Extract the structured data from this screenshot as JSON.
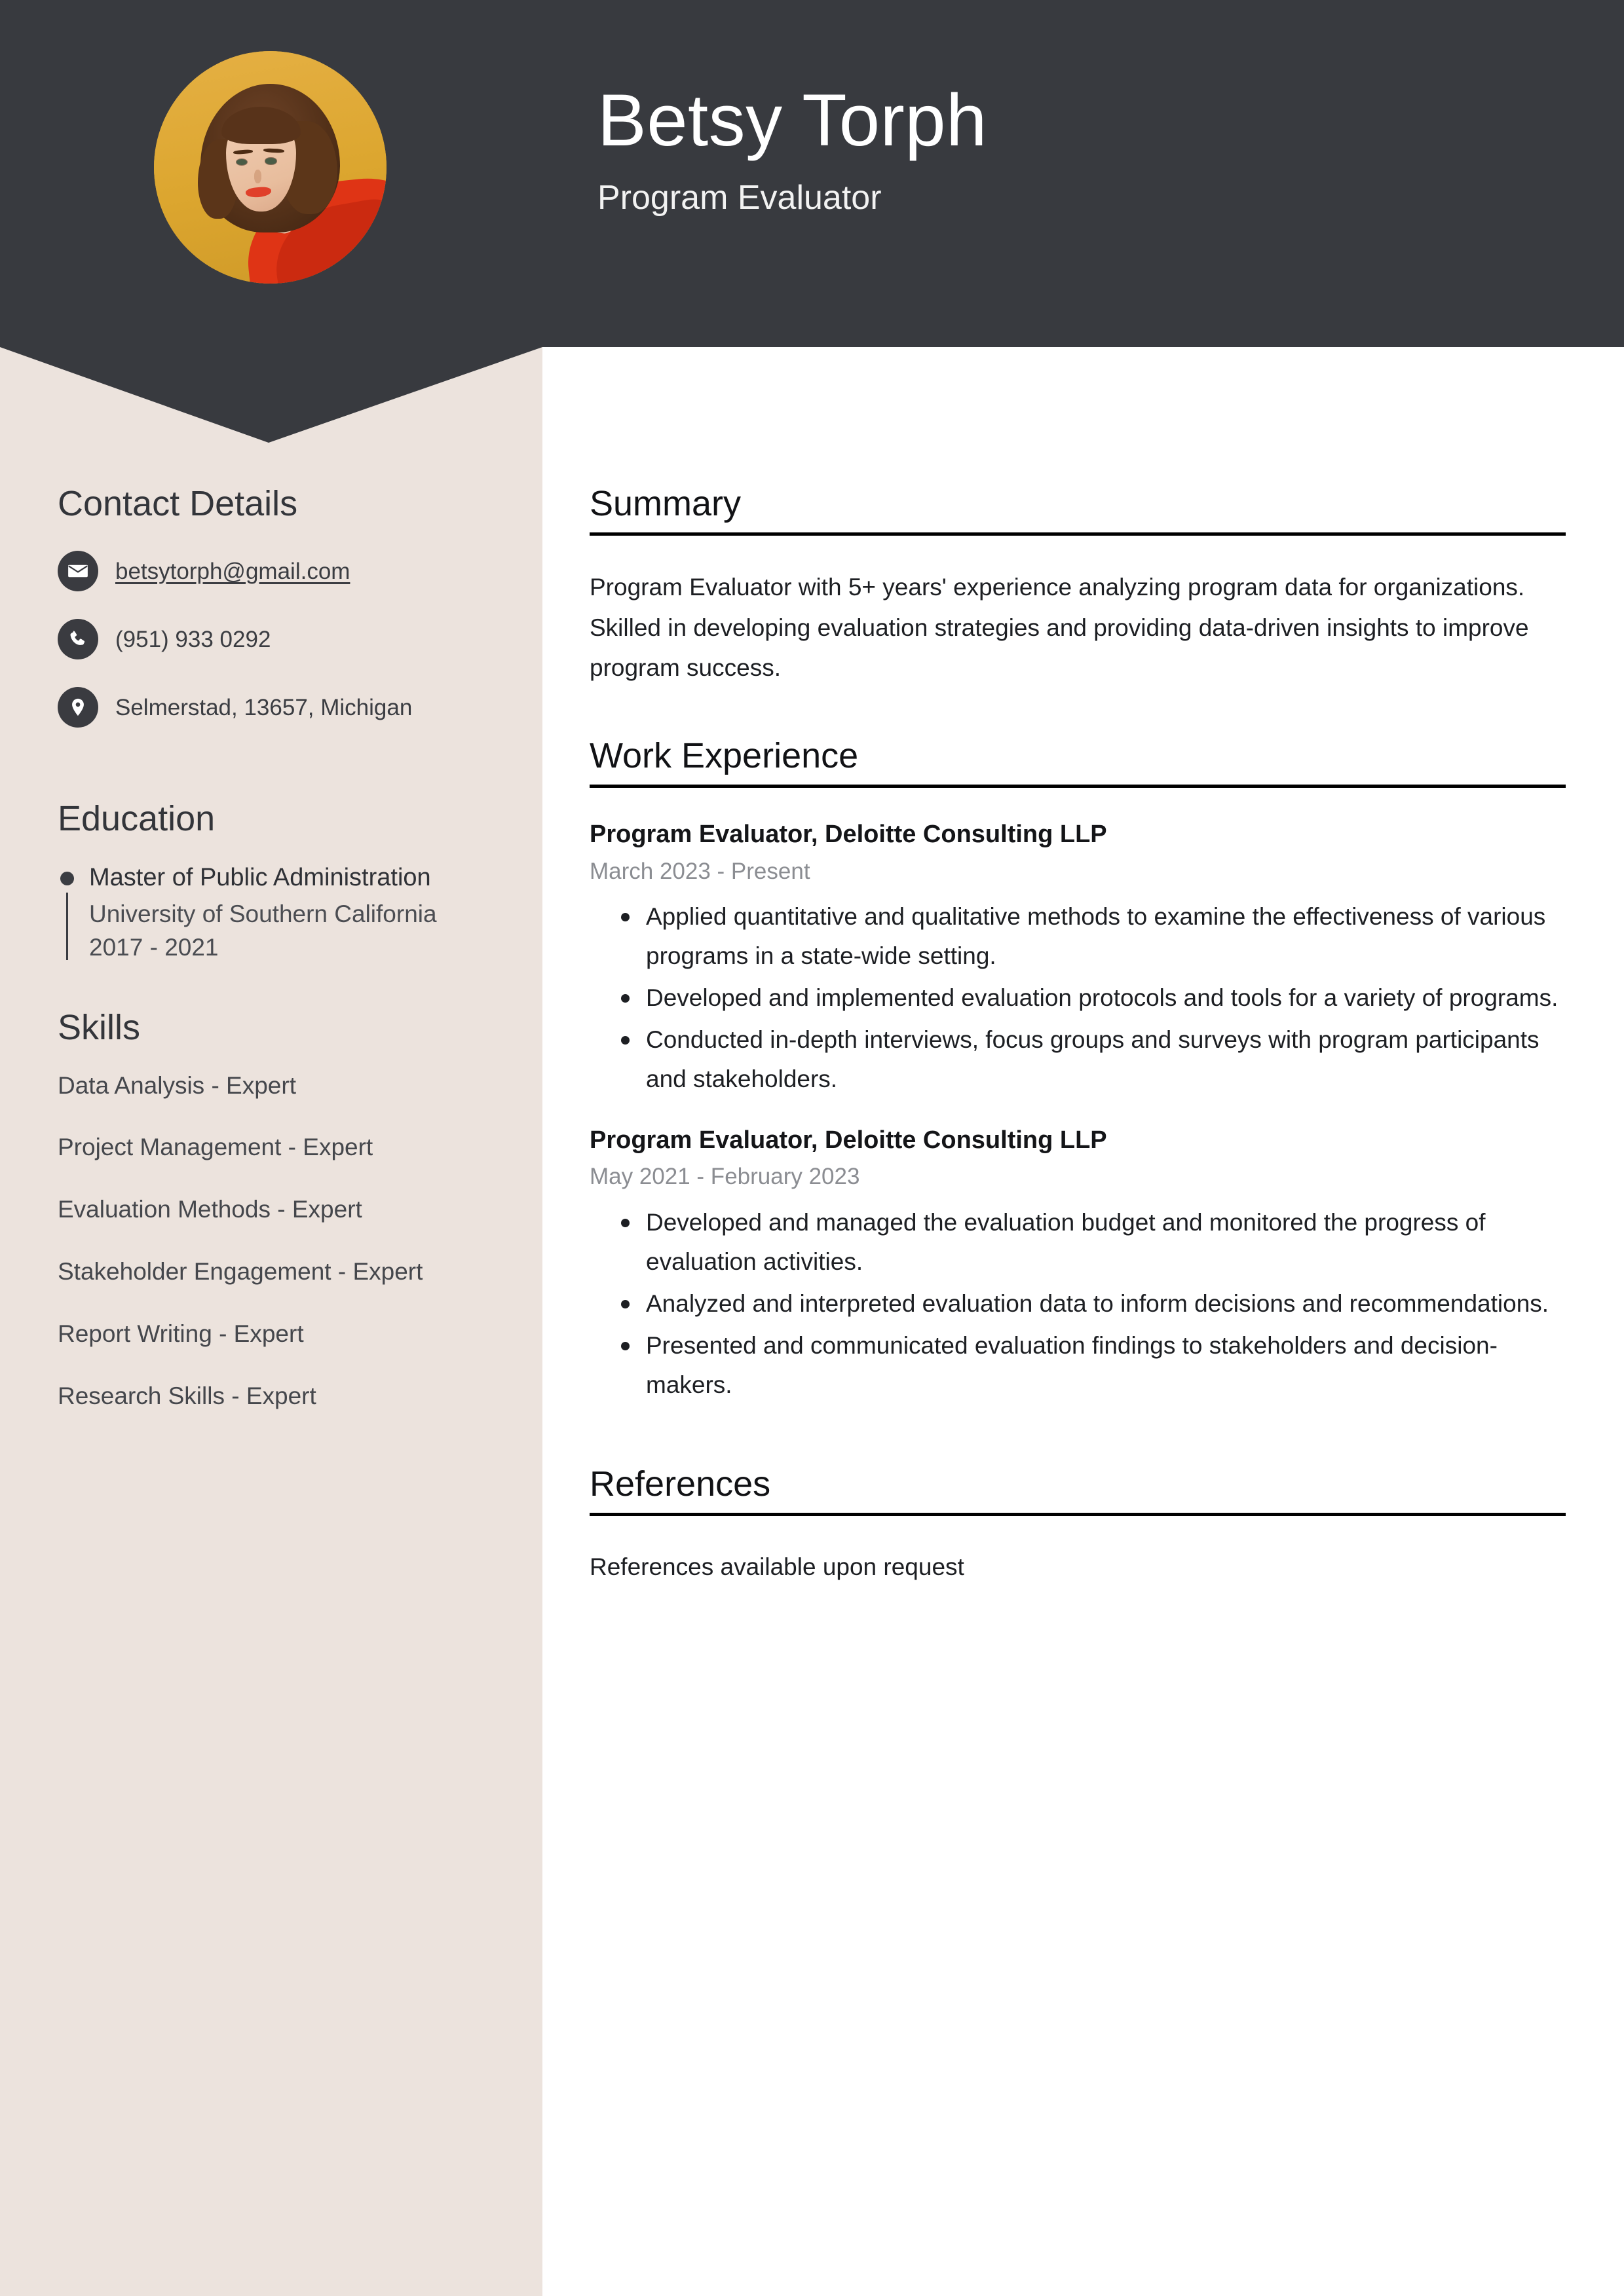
{
  "header": {
    "name": "Betsy Torph",
    "job_title": "Program Evaluator",
    "background_color": "#383a3f",
    "avatar_alt": "portrait-photo"
  },
  "sidebar": {
    "background_color": "#ece3dd",
    "contact": {
      "heading": "Contact Details",
      "items": [
        {
          "icon": "envelope-icon",
          "label": "betsytorph@gmail.com",
          "type": "email"
        },
        {
          "icon": "phone-icon",
          "label": "(951) 933 0292",
          "type": "phone"
        },
        {
          "icon": "map-pin-icon",
          "label": "Selmerstad, 13657, Michigan",
          "type": "address"
        }
      ]
    },
    "education": {
      "heading": "Education",
      "entries": [
        {
          "degree": "Master of Public Administration",
          "school": "University of Southern California",
          "dates": "2017 - 2021"
        }
      ]
    },
    "skills": {
      "heading": "Skills",
      "items": [
        "Data Analysis - Expert",
        "Project Management - Expert",
        "Evaluation Methods - Expert",
        "Stakeholder Engagement - Expert",
        "Report Writing - Expert",
        "Research Skills - Expert"
      ]
    }
  },
  "main": {
    "summary": {
      "heading": "Summary",
      "text": "Program Evaluator with 5+ years' experience analyzing program data for organizations. Skilled in developing evaluation strategies and providing data-driven insights to improve program success."
    },
    "work_experience": {
      "heading": "Work Experience",
      "entries": [
        {
          "title": "Program Evaluator, Deloitte Consulting LLP",
          "dates": "March 2023 - Present",
          "bullets": [
            "Applied quantitative and qualitative methods to examine the effectiveness of various programs in a state-wide setting.",
            "Developed and implemented evaluation protocols and tools for a variety of programs.",
            "Conducted in-depth interviews, focus groups and surveys with program participants and stakeholders."
          ]
        },
        {
          "title": "Program Evaluator, Deloitte Consulting LLP",
          "dates": "May 2021 - February 2023",
          "bullets": [
            "Developed and managed the evaluation budget and monitored the progress of evaluation activities.",
            "Analyzed and interpreted evaluation data to inform decisions and recommendations.",
            "Presented and communicated evaluation findings to stakeholders and decision-makers."
          ]
        }
      ]
    },
    "references": {
      "heading": "References",
      "text": "References available upon request"
    }
  }
}
